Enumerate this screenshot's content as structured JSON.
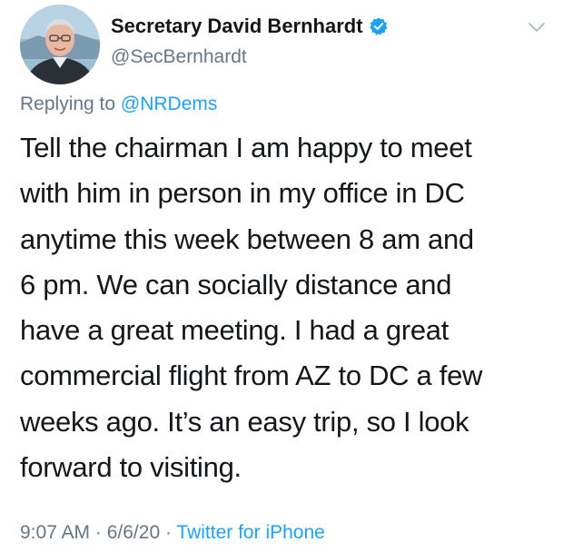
{
  "tweet": {
    "author": {
      "display_name": "Secretary David Bernhardt",
      "handle": "@SecBernhardt",
      "verified": true,
      "avatar_icon": "profile-photo"
    },
    "more_icon": "chevron-down-icon",
    "reply_context": {
      "prefix": "Replying to ",
      "mention": "@NRDems"
    },
    "body_lines": [
      "Tell the chairman I am happy to meet",
      "with him in person in my office in DC",
      "anytime this week between 8 am and",
      "6 pm. We can socially distance and",
      "have a great meeting. I had a great",
      "commercial flight from AZ to DC a few",
      "weeks ago. It’s an easy trip, so I look",
      "forward to visiting."
    ],
    "meta": {
      "time": "9:07 AM",
      "separator1": " · ",
      "date": "6/6/20",
      "separator2": " · ",
      "source": "Twitter for iPhone"
    },
    "colors": {
      "link": "#1da1f2",
      "secondary_text": "#657786",
      "primary_text": "#14171a",
      "verified_badge": "#1da1f2"
    }
  }
}
